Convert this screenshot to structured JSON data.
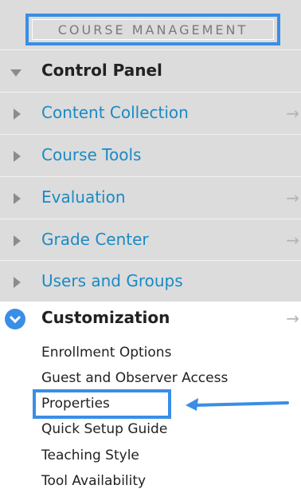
{
  "header": {
    "title": "COURSE MANAGEMENT"
  },
  "panel_items": [
    {
      "label": "Control Panel",
      "expanded": true,
      "has_arrow": false
    },
    {
      "label": "Content Collection",
      "expanded": false,
      "has_arrow": true
    },
    {
      "label": "Course Tools",
      "expanded": false,
      "has_arrow": false
    },
    {
      "label": "Evaluation",
      "expanded": false,
      "has_arrow": true
    },
    {
      "label": "Grade Center",
      "expanded": false,
      "has_arrow": true
    },
    {
      "label": "Users and Groups",
      "expanded": false,
      "has_arrow": false
    }
  ],
  "customization": {
    "label": "Customization",
    "items": [
      "Enrollment Options",
      "Guest and Observer Access",
      "Properties",
      "Quick Setup Guide",
      "Teaching Style",
      "Tool Availability"
    ]
  },
  "arrow_glyph": "→",
  "colors": {
    "accent": "#3a8ee6",
    "link": "#1a8ac4",
    "panel_bg": "#dcdcdc"
  }
}
